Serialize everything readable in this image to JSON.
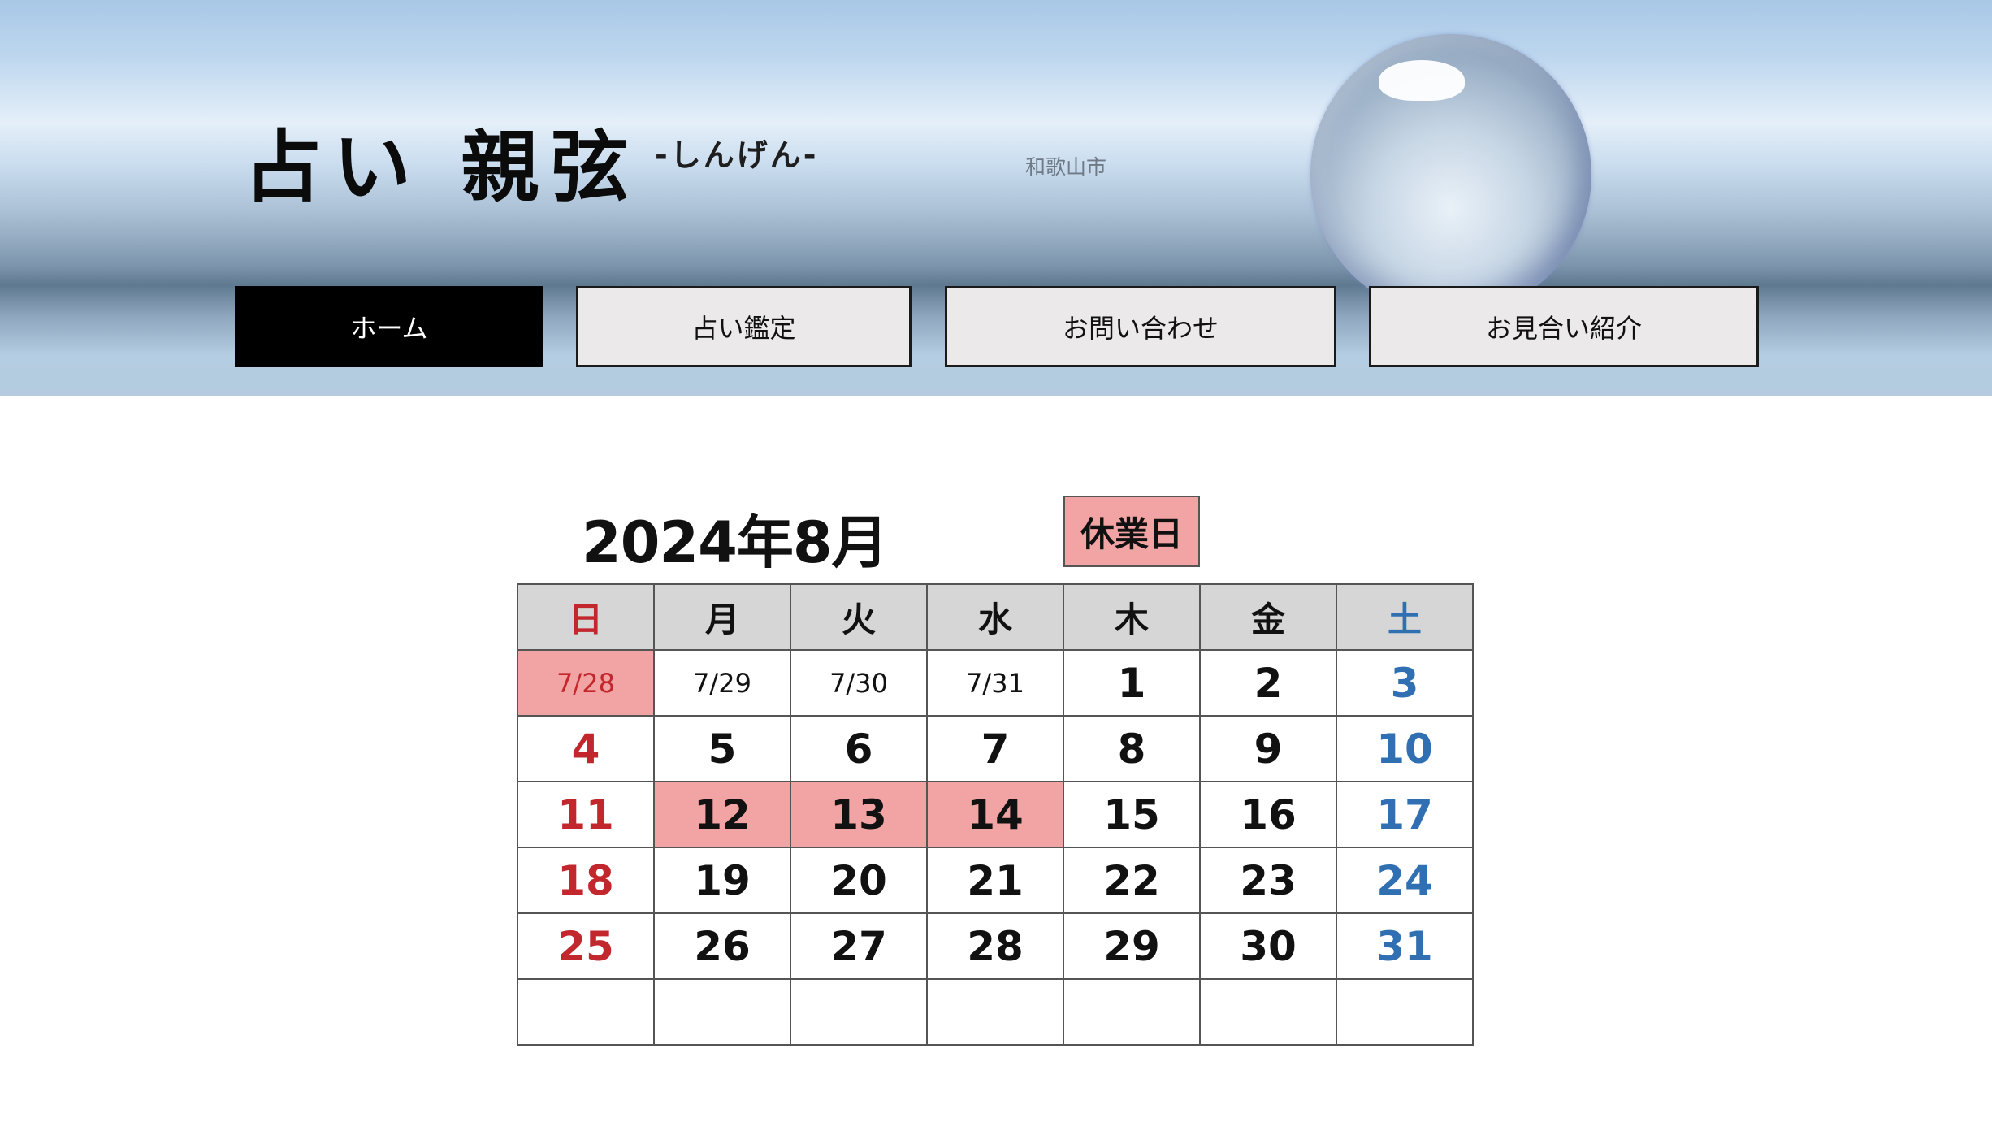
{
  "site": {
    "title": "占い 親弦",
    "subtitle": "-しんげん-",
    "location": "和歌山市"
  },
  "nav": {
    "items": [
      {
        "label": "ホーム",
        "active": true
      },
      {
        "label": "占い鑑定",
        "active": false
      },
      {
        "label": "お問い合わせ",
        "active": false
      },
      {
        "label": "お見合い紹介",
        "active": false
      }
    ]
  },
  "calendar": {
    "title": "2024年8月",
    "legend_label": "休業日",
    "legend_color": "#f2a3a3",
    "weekday_headers": [
      "日",
      "月",
      "火",
      "水",
      "木",
      "金",
      "土"
    ],
    "weeks": [
      [
        "7/28",
        "7/29",
        "7/30",
        "7/31",
        "1",
        "2",
        "3"
      ],
      [
        "4",
        "5",
        "6",
        "7",
        "8",
        "9",
        "10"
      ],
      [
        "11",
        "12",
        "13",
        "14",
        "15",
        "16",
        "17"
      ],
      [
        "18",
        "19",
        "20",
        "21",
        "22",
        "23",
        "24"
      ],
      [
        "25",
        "26",
        "27",
        "28",
        "29",
        "30",
        "31"
      ],
      [
        "",
        "",
        "",
        "",
        "",
        "",
        ""
      ]
    ],
    "closed_days": [
      "7/28",
      "12",
      "13",
      "14"
    ],
    "sunday_color": "#c2272d",
    "saturday_color": "#2f6fb2"
  }
}
